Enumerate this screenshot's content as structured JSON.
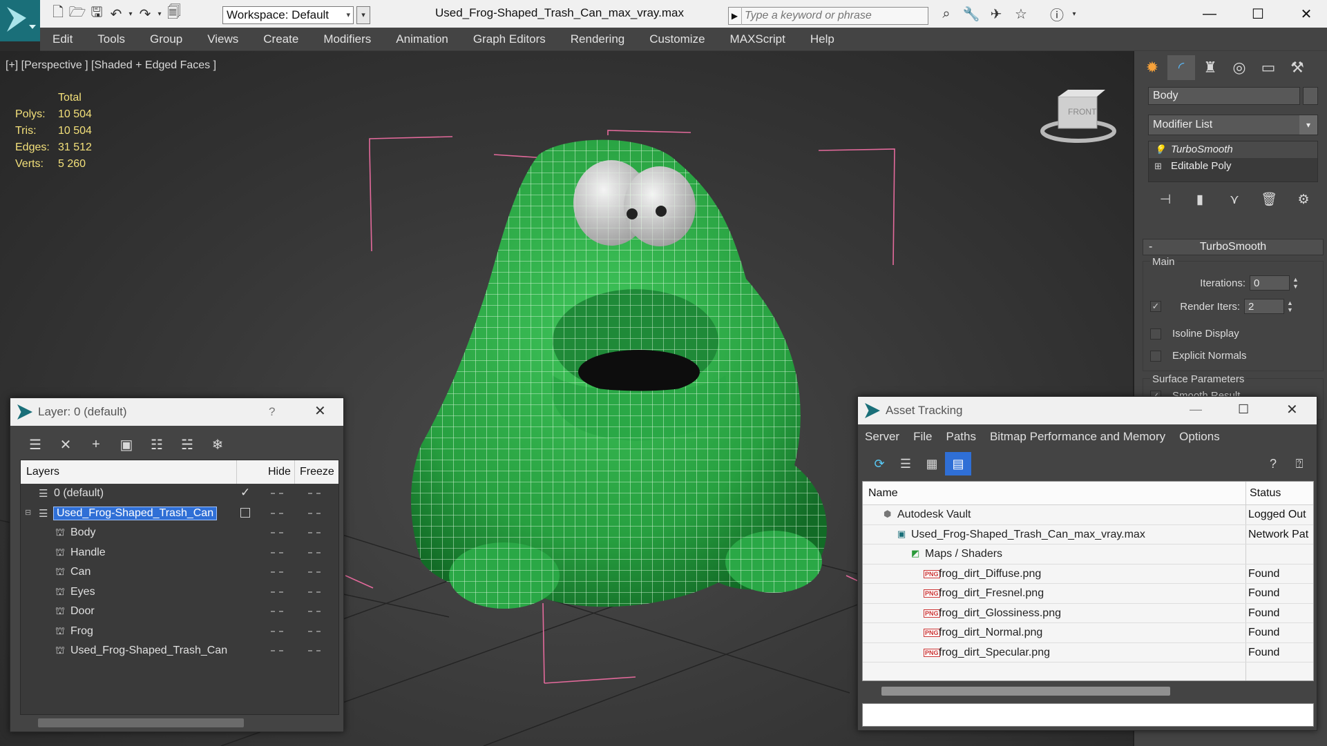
{
  "app": {
    "workspace": "Workspace: Default",
    "document_title": "Used_Frog-Shaped_Trash_Can_max_vray.max",
    "search_placeholder": "Type a keyword or phrase",
    "accent": "#1a6f79"
  },
  "menu": [
    "Edit",
    "Tools",
    "Group",
    "Views",
    "Create",
    "Modifiers",
    "Animation",
    "Graph Editors",
    "Rendering",
    "Customize",
    "MAXScript",
    "Help"
  ],
  "viewport": {
    "label": "[+] [Perspective ] [Shaded + Edged Faces ]",
    "stats": {
      "header": "Total",
      "rows": [
        {
          "label": "Polys:",
          "value": "10 504"
        },
        {
          "label": "Tris:",
          "value": "10 504"
        },
        {
          "label": "Edges:",
          "value": "31 512"
        },
        {
          "label": "Verts:",
          "value": "5 260"
        }
      ]
    },
    "model_color": "#2fa84a",
    "viewcube_label": "FRONT"
  },
  "command_panel": {
    "object_name": "Body",
    "modifier_list": "Modifier List",
    "stack": [
      "TurboSmooth",
      "Editable Poly"
    ],
    "rollout_title": "TurboSmooth",
    "main_group": "Main",
    "iterations_label": "Iterations:",
    "iterations_value": "0",
    "render_iters_label": "Render Iters:",
    "render_iters_value": "2",
    "isoline_label": "Isoline Display",
    "explicit_label": "Explicit Normals",
    "surface_group": "Surface Parameters",
    "smooth_label": "Smooth Result"
  },
  "layer_dialog": {
    "title": "Layer: 0 (default)",
    "help": "?",
    "columns": {
      "layers": "Layers",
      "hide": "Hide",
      "freeze": "Freeze"
    },
    "rows": [
      {
        "name": "0 (default)",
        "level": 0,
        "type": "layer"
      },
      {
        "name": "Used_Frog-Shaped_Trash_Can",
        "level": 0,
        "type": "layer",
        "selected": true
      },
      {
        "name": "Body",
        "level": 1,
        "type": "object"
      },
      {
        "name": "Handle",
        "level": 1,
        "type": "object"
      },
      {
        "name": "Can",
        "level": 1,
        "type": "object"
      },
      {
        "name": "Eyes",
        "level": 1,
        "type": "object"
      },
      {
        "name": "Door",
        "level": 1,
        "type": "object"
      },
      {
        "name": "Frog",
        "level": 1,
        "type": "object"
      },
      {
        "name": "Used_Frog-Shaped_Trash_Can",
        "level": 1,
        "type": "object"
      }
    ]
  },
  "asset_dialog": {
    "title": "Asset Tracking",
    "menu": [
      "Server",
      "File",
      "Paths",
      "Bitmap Performance and Memory",
      "Options"
    ],
    "columns": {
      "name": "Name",
      "status": "Status"
    },
    "rows": [
      {
        "name": "Autodesk Vault",
        "status": "Logged Out",
        "level": 0,
        "icon": "vault"
      },
      {
        "name": "Used_Frog-Shaped_Trash_Can_max_vray.max",
        "status": "Network Pat",
        "level": 1,
        "icon": "max"
      },
      {
        "name": "Maps / Shaders",
        "status": "",
        "level": 2,
        "icon": "maps"
      },
      {
        "name": "frog_dirt_Diffuse.png",
        "status": "Found",
        "level": 3,
        "icon": "png"
      },
      {
        "name": "frog_dirt_Fresnel.png",
        "status": "Found",
        "level": 3,
        "icon": "png"
      },
      {
        "name": "frog_dirt_Glossiness.png",
        "status": "Found",
        "level": 3,
        "icon": "png"
      },
      {
        "name": "frog_dirt_Normal.png",
        "status": "Found",
        "level": 3,
        "icon": "png"
      },
      {
        "name": "frog_dirt_Specular.png",
        "status": "Found",
        "level": 3,
        "icon": "png"
      }
    ]
  }
}
